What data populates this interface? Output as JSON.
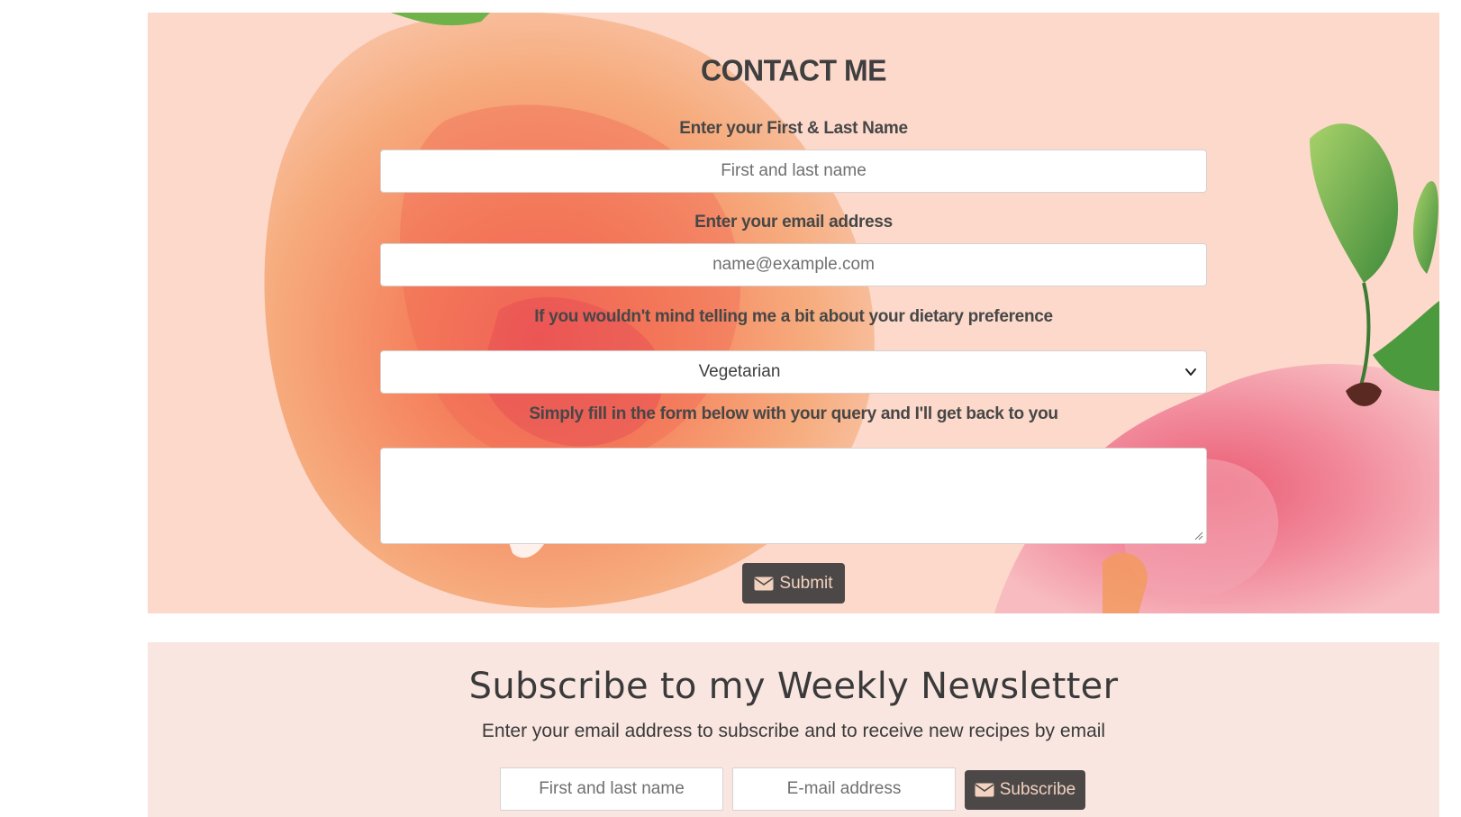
{
  "contact": {
    "title": "CONTACT ME",
    "name_label": "Enter your First & Last Name",
    "name_placeholder": "First and last name",
    "email_label": "Enter your email address",
    "email_placeholder": "name@example.com",
    "diet_label": "If you wouldn't mind telling me a bit about your dietary preference",
    "diet_selected": "Vegetarian",
    "query_label": "Simply fill in the form below with your query and I'll get back to you",
    "submit_label": "Submit",
    "submit_icon": "envelope-icon"
  },
  "newsletter": {
    "title": "Subscribe to my Weekly Newsletter",
    "subtitle": "Enter your email address to subscribe and to receive new recipes by email",
    "name_placeholder": "First and last name",
    "email_placeholder": "E-mail address",
    "subscribe_label": "Subscribe",
    "subscribe_icon": "envelope-icon"
  },
  "colors": {
    "contact_background": "#fcd9cb",
    "newsletter_background": "#f9e6e0",
    "button_background": "#4c4848",
    "button_text": "#f3d2bf"
  }
}
